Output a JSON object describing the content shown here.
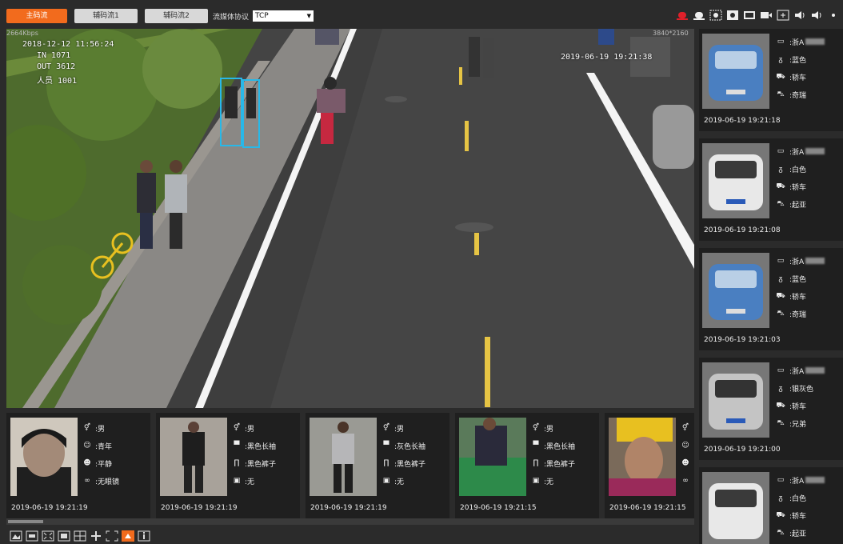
{
  "topbar": {
    "tabs": [
      {
        "label": "主码流"
      },
      {
        "label": "辅码流1"
      },
      {
        "label": "辅码流2"
      }
    ],
    "protocol_label": "流媒体协议",
    "protocol_value": "TCP",
    "accent": "#f26b1d"
  },
  "video": {
    "bitrate": "2664Kbps",
    "resolution": "3840*2160",
    "osd_datetime": "2018-12-12 11:56:24",
    "osd_line2": "IN 1071",
    "osd_line3": "OUT 3612",
    "osd_line4": "人员 1001",
    "osd_timestamp": "2019-06-19 19:21:38"
  },
  "person_cards": [
    {
      "attrs": [
        {
          "icon": "gender-icon",
          "text": ":男"
        },
        {
          "icon": "age-icon",
          "text": ":青年"
        },
        {
          "icon": "face-icon",
          "text": ":平静"
        },
        {
          "icon": "glasses-icon",
          "text": ":无眼镜"
        }
      ],
      "time": "2019-06-19 19:21:19"
    },
    {
      "attrs": [
        {
          "icon": "gender-icon",
          "text": ":男"
        },
        {
          "icon": "shirt-icon",
          "text": ":黑色长袖"
        },
        {
          "icon": "pants-icon",
          "text": ":黑色裤子"
        },
        {
          "icon": "bag-icon",
          "text": ":无"
        }
      ],
      "time": "2019-06-19 19:21:19"
    },
    {
      "attrs": [
        {
          "icon": "gender-icon",
          "text": ":男"
        },
        {
          "icon": "shirt-icon",
          "text": ":灰色长袖"
        },
        {
          "icon": "pants-icon",
          "text": ":黑色裤子"
        },
        {
          "icon": "bag-icon",
          "text": ":无"
        }
      ],
      "time": "2019-06-19 19:21:19"
    },
    {
      "attrs": [
        {
          "icon": "gender-icon",
          "text": ":男"
        },
        {
          "icon": "shirt-icon",
          "text": ":黑色长袖"
        },
        {
          "icon": "pants-icon",
          "text": ":黑色裤子"
        },
        {
          "icon": "bag-icon",
          "text": ":无"
        }
      ],
      "time": "2019-06-19 19:21:15"
    },
    {
      "attrs": [],
      "time": "2019-06-19 19:21:15"
    }
  ],
  "vehicle_cards": [
    {
      "plate": ":浙A",
      "color": ":蓝色",
      "type": ":轿车",
      "brand": ":奇瑞",
      "time": "2019-06-19 19:21:18",
      "car_color": "#4a7fc1"
    },
    {
      "plate": ":浙A",
      "color": ":白色",
      "type": ":轿车",
      "brand": ":起亚",
      "time": "2019-06-19 19:21:08",
      "car_color": "#e8e8e8"
    },
    {
      "plate": ":浙A",
      "color": ":蓝色",
      "type": ":轿车",
      "brand": ":奇瑞",
      "time": "2019-06-19 19:21:03",
      "car_color": "#4a7fc1"
    },
    {
      "plate": ":浙A",
      "color": ":银灰色",
      "type": ":轿车",
      "brand": ":兄弟",
      "time": "2019-06-19 19:21:00",
      "car_color": "#c4c4c4"
    },
    {
      "plate": ":浙A",
      "color": ":白色",
      "type": ":轿车",
      "brand": ":起亚",
      "time": "",
      "car_color": "#e8e8e8"
    }
  ]
}
